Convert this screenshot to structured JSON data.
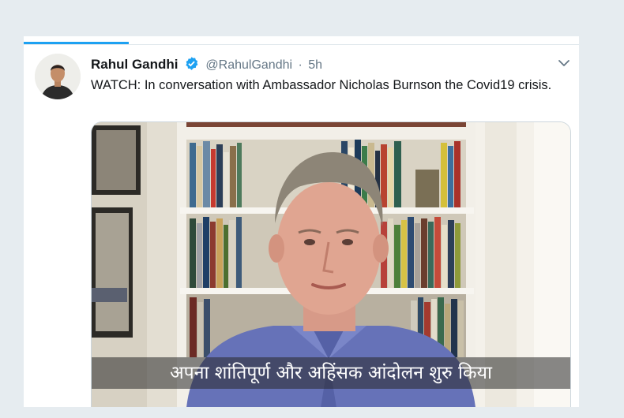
{
  "tweet": {
    "author_name": "Rahul Gandhi",
    "handle": "@RahulGandhi",
    "separator": "·",
    "time": "5h",
    "text": "WATCH: In conversation with Ambassador Nicholas Burnson the Covid19 crisis."
  },
  "media": {
    "subtitle": "अपना शांतिपूर्ण और अहिंसक आंदोलन शुरु किया"
  },
  "icons": {
    "verified": "verified-badge-icon",
    "menu": "chevron-down-icon"
  },
  "colors": {
    "accent": "#1da1f2",
    "background": "#e6ecf0",
    "secondary_text": "#657786"
  }
}
